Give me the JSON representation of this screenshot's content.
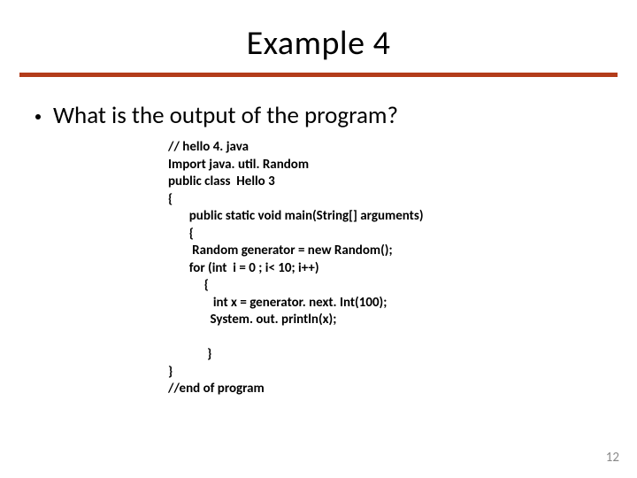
{
  "title": "Example 4",
  "bullet": "What is the output of the program?",
  "code_lines": [
    "// hello 4. java",
    "Import java. util. Random",
    "public class  Hello 3",
    "{",
    "       public static void main(String[] arguments)",
    "       {",
    "        Random generator = new Random();",
    "       for (int  i = 0 ; i< 10; i++)",
    "            {",
    "               int x = generator. next. Int(100);",
    "              System. out. println(x);",
    "",
    "             }",
    "}",
    "//end of program"
  ],
  "page_number": "12"
}
